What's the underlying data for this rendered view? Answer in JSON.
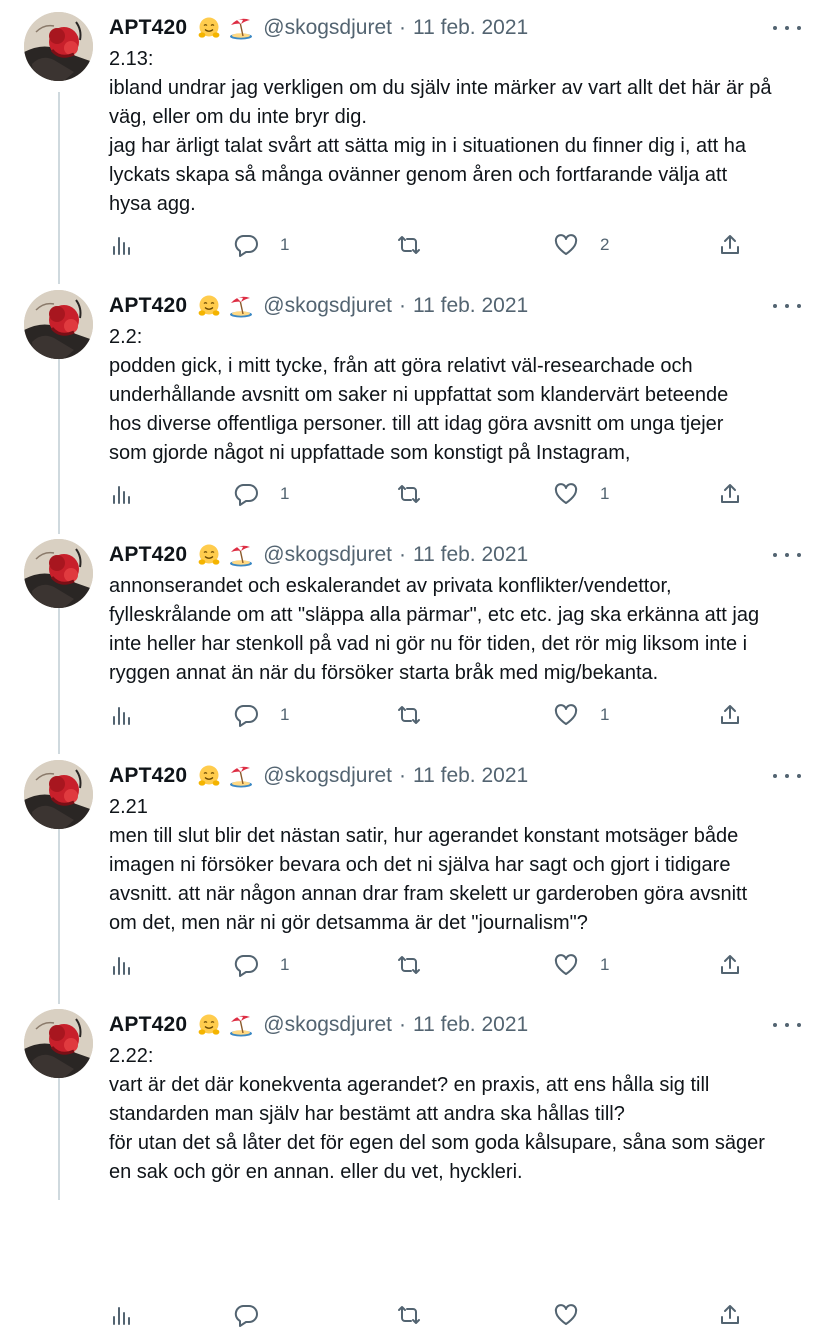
{
  "tweets": [
    {
      "name": "APT420",
      "emoji1": "hugging-face-emoji",
      "emoji2": "beach-umbrella-emoji",
      "handle": "@skogsdjuret",
      "separator": "·",
      "date": "11 feb. 2021",
      "lines": [
        "2.13:",
        "ibland undrar jag verkligen om du själv inte märker av vart allt det här är på",
        "väg, eller om du inte bryr dig.",
        "jag har ärligt talat svårt att sätta mig in i situationen du finner dig i, att ha",
        "lyckats skapa så många ovänner genom åren och fortfarande välja att",
        "hysa agg."
      ],
      "replies": "1",
      "retweets": "",
      "likes": "2"
    },
    {
      "name": "APT420",
      "emoji1": "hugging-face-emoji",
      "emoji2": "beach-umbrella-emoji",
      "handle": "@skogsdjuret",
      "separator": "·",
      "date": "11 feb. 2021",
      "lines": [
        "2.2:",
        "podden gick, i mitt tycke, från att göra relativt väl-researchade och",
        "underhållande avsnitt om saker ni uppfattat som klandervärt beteende",
        "hos diverse offentliga personer. till att idag göra avsnitt om unga tjejer",
        "som gjorde något ni uppfattade som konstigt på Instagram,"
      ],
      "replies": "1",
      "retweets": "",
      "likes": "1"
    },
    {
      "name": "APT420",
      "emoji1": "hugging-face-emoji",
      "emoji2": "beach-umbrella-emoji",
      "handle": "@skogsdjuret",
      "separator": "·",
      "date": "11 feb. 2021",
      "lines": [
        "annonserandet och eskalerandet av privata konflikter/vendettor,",
        "fylleskrålande om att \"släppa alla pärmar\", etc etc. jag ska erkänna att jag",
        "inte heller har stenkoll på vad ni gör nu för tiden, det rör mig liksom inte i",
        "ryggen annat än när du försöker starta bråk med mig/bekanta."
      ],
      "replies": "1",
      "retweets": "",
      "likes": "1"
    },
    {
      "name": "APT420",
      "emoji1": "hugging-face-emoji",
      "emoji2": "beach-umbrella-emoji",
      "handle": "@skogsdjuret",
      "separator": "·",
      "date": "11 feb. 2021",
      "lines": [
        "2.21",
        "men till slut blir det nästan satir, hur agerandet konstant motsäger både",
        "imagen ni försöker bevara och det ni själva har sagt och gjort i tidigare",
        "avsnitt. att när någon annan drar fram skelett ur garderoben göra avsnitt",
        "om det, men när ni gör detsamma är det \"journalism\"?"
      ],
      "replies": "1",
      "retweets": "",
      "likes": "1"
    },
    {
      "name": "APT420",
      "emoji1": "hugging-face-emoji",
      "emoji2": "beach-umbrella-emoji",
      "handle": "@skogsdjuret",
      "separator": "·",
      "date": "11 feb. 2021",
      "lines": [
        "2.22:",
        "vart är det där konekventa agerandet? en praxis, att ens hålla sig till",
        "standarden man själv har bestämt att andra ska hållas till?",
        "för utan det så låter det för egen del som goda kålsupare, såna som säger",
        "en sak och gör en annan. eller du vet, hyckleri."
      ],
      "replies": "",
      "retweets": "",
      "likes": ""
    }
  ],
  "icons": {
    "views": "bar-chart-icon",
    "reply": "reply-bubble-icon",
    "retweet": "retweet-icon",
    "like": "heart-icon",
    "share": "share-upload-icon",
    "more": "more-dots-icon"
  },
  "colors": {
    "text": "#0f1419",
    "secondary": "#536471",
    "thread_line": "#cfd9de",
    "avatar_hair": "#c8202b"
  }
}
